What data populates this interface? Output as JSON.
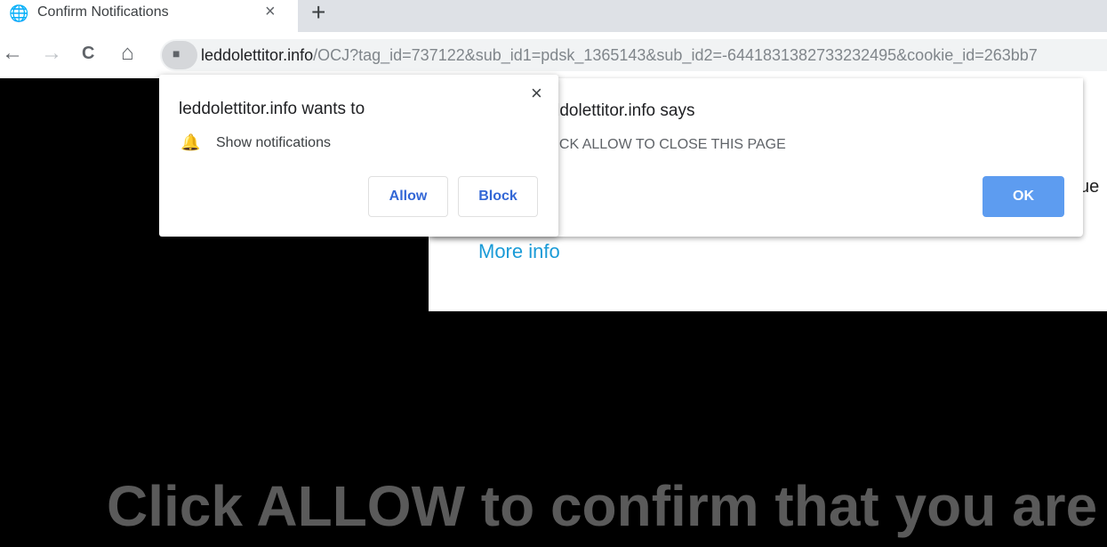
{
  "tab": {
    "title": "Confirm Notifications",
    "icon": "globe-icon",
    "close": "×",
    "new_tab": "+"
  },
  "toolbar": {
    "back": "←",
    "forward": "→",
    "reload": "C",
    "home": "⌂",
    "lock": "🔒",
    "url_host": "leddolettitor.info",
    "url_path": "/OCJ?tag_id=737122&sub_id1=pdsk_1365143&sub_id2=-6441831382733232495&cookie_id=263bb7"
  },
  "permission": {
    "title": "leddolettitor.info wants to",
    "item": "Show notifications",
    "close": "×",
    "allow": "Allow",
    "block": "Block"
  },
  "alert": {
    "title": "leddolettitor.info says",
    "message": "CLICK ALLOW TO CLOSE THIS PAGE",
    "ok": "OK"
  },
  "page": {
    "more_info": "More info",
    "partial": "ue",
    "headline": "Click ALLOW to confirm that you are"
  },
  "colors": {
    "ok_button": "#5d9cf0",
    "link": "#1a9bd7",
    "allow_text": "#3367d6"
  }
}
